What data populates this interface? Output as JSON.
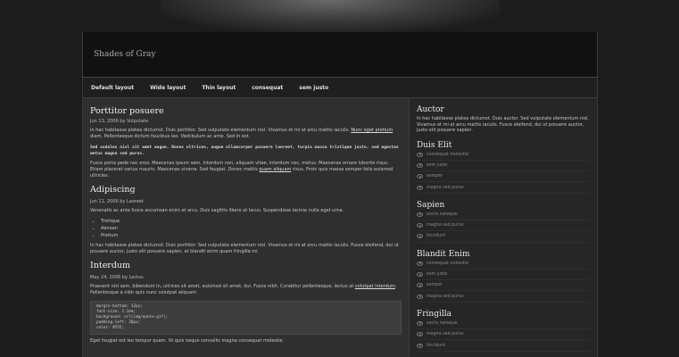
{
  "header": {
    "title": "Shades of Gray"
  },
  "nav": [
    "Default layout",
    "Wide layout",
    "Thin layout",
    "consequat",
    "sem justo"
  ],
  "posts": [
    {
      "title": "Porttitor posuere",
      "meta": "Jun 13, 2006 by Vulputate",
      "p1_before": "In hac habitasse platea dictumst. Duis porttitor. Sed vulputate elementum nisl. Vivamus et mi at arcu mattis iaculis. ",
      "p1_link": "Nunc eget pretium",
      "p1_after": " diam. Pellentesque dictum faucibus leo. Vestibulum ac ante. Sed in est.",
      "mono": "Sed sodales nisl sit amet augue. Donec ultrices, augue ullamcorper posuere laoreet, turpis massa tristique justo, sed egestas metus magna sed purus.",
      "p2_before": "Fusce porta pede nec eros. Maecenas ipsum sem, interdum non, aliquam vitae, interdum nec, metus. Maecenas ornare lobortis risus. Etiam placerat varius mauris. Maecenas viverra. Sed feugiat. Donec mattis ",
      "p2_link": "quam aliquam",
      "p2_after": " risus. Proin quis massa semper felis euismod ultricies."
    },
    {
      "title": "Adipiscing",
      "meta": "Jun 11, 2006 by Laoreet",
      "p1": "Venenatis ac ante fusce accumsan enim et arcu. Duis sagittis libero at lacus. Suspendisse lacinia nulla eget urna.",
      "list": [
        "Tristique",
        "Aenean",
        "Pretium"
      ],
      "p2": "In hac habitasse platea dictumst. Duis porttitor. Sed vulputate elementum nisl. Vivamus et mi at arcu mattis iaculis. Fusce eleifend, dui ut posuere auctor, justo elit posuere sapien, at blandit enim quam fringilla mi."
    },
    {
      "title": "Interdum",
      "meta": "May 24, 2006 by Lectus",
      "p1_before": "Praesent nisi sem, bibendum in, ultrices sit amet, euismod sit amet, dui. Fusce nibh. Curabitur pellentesque, lectus at ",
      "p1_link": "volutpat interdum",
      "p1_after": ". Pellentesque a nibh quis nunc volutpat aliquam",
      "code": "margin-bottom: 12px;\nfont-size: 1.1em;\nbackground: url(img/quote.gif);\npadding-left: 28px;\ncolor: #555;",
      "p2": "Eget feugiat est leo tempor quam. Ut quis neque convallis magna consequat molestie."
    }
  ],
  "sidebar": {
    "about_title": "Auctor",
    "about_text": "In hac habitasse platea dictumst. Duis auctor. Sed vulputate elementum nisl. Vivamus et mi at arcu mattis iaculis. Fusce eleifend, dui ut posuere auctor, justo elit posuere sapien.",
    "sections": [
      {
        "title": "Duis Elit",
        "items": [
          "consequat molestie",
          "sem justo",
          "semper",
          "magna sed purus"
        ]
      },
      {
        "title": "Sapien",
        "items": [
          "sociis natoque",
          "magna sed purus",
          "tincidunt"
        ]
      },
      {
        "title": "Blandit Enim",
        "items": [
          "consequat molestie",
          "sem justo",
          "semper",
          "magna sed purus"
        ]
      },
      {
        "title": "Fringilla",
        "items": [
          "sociis natoque",
          "magna sed purus",
          "tincidunt"
        ]
      }
    ]
  }
}
